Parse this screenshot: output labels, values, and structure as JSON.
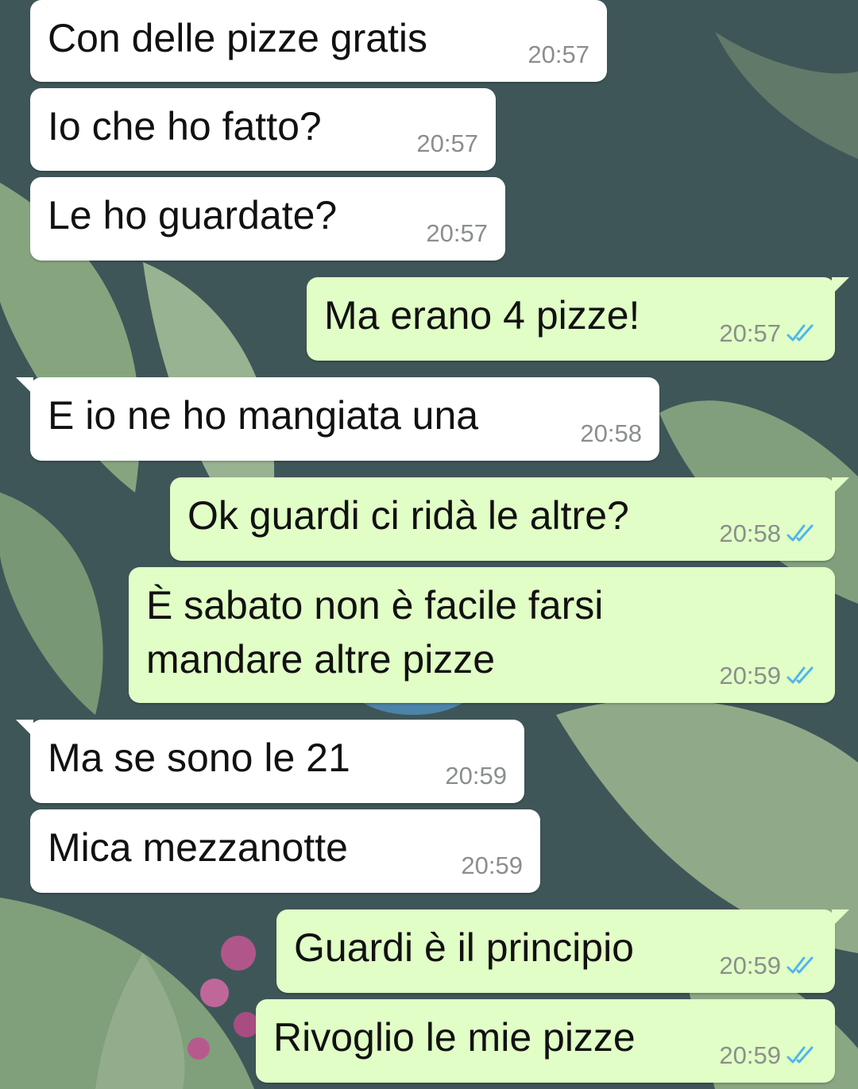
{
  "theme": {
    "incoming_bg": "#ffffff",
    "outgoing_bg": "#e1fec6",
    "read_tick": "#4fb6ec",
    "time_color": "#8a8f8c"
  },
  "messages": [
    {
      "direction": "incoming",
      "text": "Con delle pizze gratis",
      "time": "20:57"
    },
    {
      "direction": "incoming",
      "text": "Io che ho fatto?",
      "time": "20:57"
    },
    {
      "direction": "incoming",
      "text": "Le ho guardate?",
      "time": "20:57"
    },
    {
      "direction": "outgoing",
      "text": "Ma erano 4 pizze!",
      "time": "20:57",
      "status": "read-double-check-icon"
    },
    {
      "direction": "incoming",
      "text": "E io ne ho mangiata una",
      "time": "20:58"
    },
    {
      "direction": "outgoing",
      "text": "Ok guardi ci ridà le altre?",
      "time": "20:58",
      "status": "read-double-check-icon"
    },
    {
      "direction": "outgoing",
      "text": "È sabato non è facile farsi\nmandare altre pizze",
      "time": "20:59",
      "status": "read-double-check-icon"
    },
    {
      "direction": "incoming",
      "text": "Ma se sono le 21",
      "time": "20:59"
    },
    {
      "direction": "incoming",
      "text": "Mica mezzanotte",
      "time": "20:59"
    },
    {
      "direction": "outgoing",
      "text": "Guardi è il principio",
      "time": "20:59",
      "status": "read-double-check-icon"
    },
    {
      "direction": "outgoing",
      "text": "Rivoglio le mie pizze",
      "time": "20:59",
      "status": "read-double-check-icon"
    }
  ]
}
